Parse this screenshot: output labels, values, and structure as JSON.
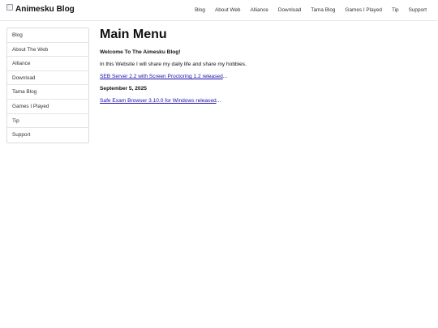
{
  "header": {
    "brand_title": "Animesku Blog",
    "brand_image_alt": "logo",
    "nav": [
      {
        "label": "Blog"
      },
      {
        "label": "About Web"
      },
      {
        "label": "Alliance"
      },
      {
        "label": "Download"
      },
      {
        "label": "Tama Blog"
      },
      {
        "label": "Games I Played"
      },
      {
        "label": "Tip"
      },
      {
        "label": "Support"
      }
    ]
  },
  "sidebar": {
    "items": [
      {
        "label": "Blog"
      },
      {
        "label": "About The Web"
      },
      {
        "label": "Alliance"
      },
      {
        "label": "Download"
      },
      {
        "label": "Tama Blog"
      },
      {
        "label": "Games I Played"
      },
      {
        "label": "Tip"
      },
      {
        "label": "Support"
      }
    ]
  },
  "main": {
    "title": "Main Menu",
    "welcome": "Welcome To The Aimesku Blog!",
    "intro": "In this Website I will share my daily life and share my hobbies.",
    "posts": [
      {
        "link_text": "SEB Server 2.2 with Screen Proctoring 1.2 released",
        "suffix": "..."
      },
      {
        "date": "September 5, 2025"
      },
      {
        "link_text": "Safe Exam Browser 3.10.0 for Windows released",
        "suffix": "..."
      }
    ]
  }
}
